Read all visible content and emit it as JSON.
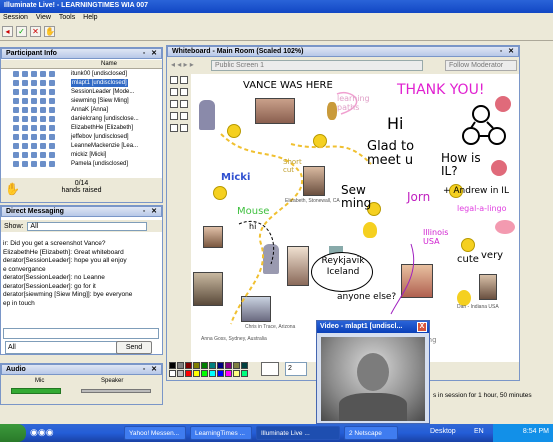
{
  "window": {
    "title": "Illuminate Live! - LEARNINGTIMES WIA 007"
  },
  "menu": [
    "Session",
    "View",
    "Tools",
    "Help"
  ],
  "participants": {
    "header": "Participant Info",
    "column_name": "Name",
    "rows": [
      "itunk00 [undisclosed]",
      "mlapt1 [undisclosed]",
      "SessionLeader [Mode...",
      "siewming [Siew Ming]",
      "AnnaK [Anna]",
      "danielcrang [undisclose...",
      "ElizabethHe [Elizabeth]",
      "jeffebov [undisclosed]",
      "LeanneMackenzie [Lea...",
      "mickiz [Micki]",
      "Pamela [undisclosed]"
    ],
    "selected_index": 1,
    "hands_count": "0/14",
    "hands_label": "hands raised"
  },
  "direct_messaging": {
    "header": "Direct Messaging",
    "show_label": "Show:",
    "show_value": "All",
    "messages": [
      "ir: Did you get a screenshot Vance?",
      "ElizabethHe [Elizabeth]: Great whiteboard",
      "derator[SessionLeader]: hope you all enjoy",
      "e convergance",
      "derator[SessionLeader]: no Leanne",
      "derator[SessionLeader]: go for it",
      "derator[siewming [Siew Ming]]: bye everyone",
      "ep in touch"
    ],
    "send_to": "All",
    "send_label": "Send"
  },
  "audio": {
    "header": "Audio",
    "mic_label": "Mic",
    "speaker_label": "Speaker"
  },
  "whiteboard": {
    "header": "Whiteboard - Main Room (Scaled 102%)",
    "screen_select": "Public Screen 1",
    "follow_label": "Follow Moderator",
    "page_value": "2",
    "texts": {
      "vance": "VANCE WAS HERE",
      "learning": "learning paths",
      "thank": "THANK YOU!",
      "hi": "Hi",
      "glad": "Glad to meet u",
      "how": "How is IL?",
      "andrew": "+ Andrew in IL",
      "micki": "Micki",
      "mouse": "Mouse",
      "sewming": "Sew ming",
      "jorn": "Jorn",
      "legal": "legal-a-lingo",
      "illinois": "Illinois USA",
      "hi2": "hi",
      "reykjavik": "Reykjavik Iceland",
      "anyone": "anyone else?",
      "cute": "cute",
      "very": "very",
      "shortcut": "Short cut",
      "siewming_sig": "Siew Ming"
    },
    "captions": {
      "elizabeth": "Elizabeth, Stonewall, CA",
      "chris": "Chris in Trace, Arizona",
      "anna": "Anna Goss, Sydney, Australia",
      "dan": "Dan - Indiana USA"
    },
    "palette": [
      "#000000",
      "#7f7f7f",
      "#7f0000",
      "#7f7f00",
      "#007f00",
      "#007f7f",
      "#00007f",
      "#7f007f",
      "#7f7f3f",
      "#003f3f",
      "#ffffff",
      "#c0c0c0",
      "#ff0000",
      "#ffff00",
      "#00ff00",
      "#00ffff",
      "#0000ff",
      "#ff00ff",
      "#ffff7f",
      "#00ff7f"
    ]
  },
  "video": {
    "title": "Video - mlapt1 [undiscl...",
    "close": "X"
  },
  "status": {
    "text": "s in session for 1 hour, 50 minutes"
  },
  "taskbar": {
    "tasks": [
      "Yahoo! Messen...",
      "LearningTimes ...",
      "Illuminate Live ...",
      "2 Netscape"
    ],
    "active_index": 2,
    "tray_label": "Desktop",
    "lang": "EN",
    "clock": "8:54 PM"
  }
}
